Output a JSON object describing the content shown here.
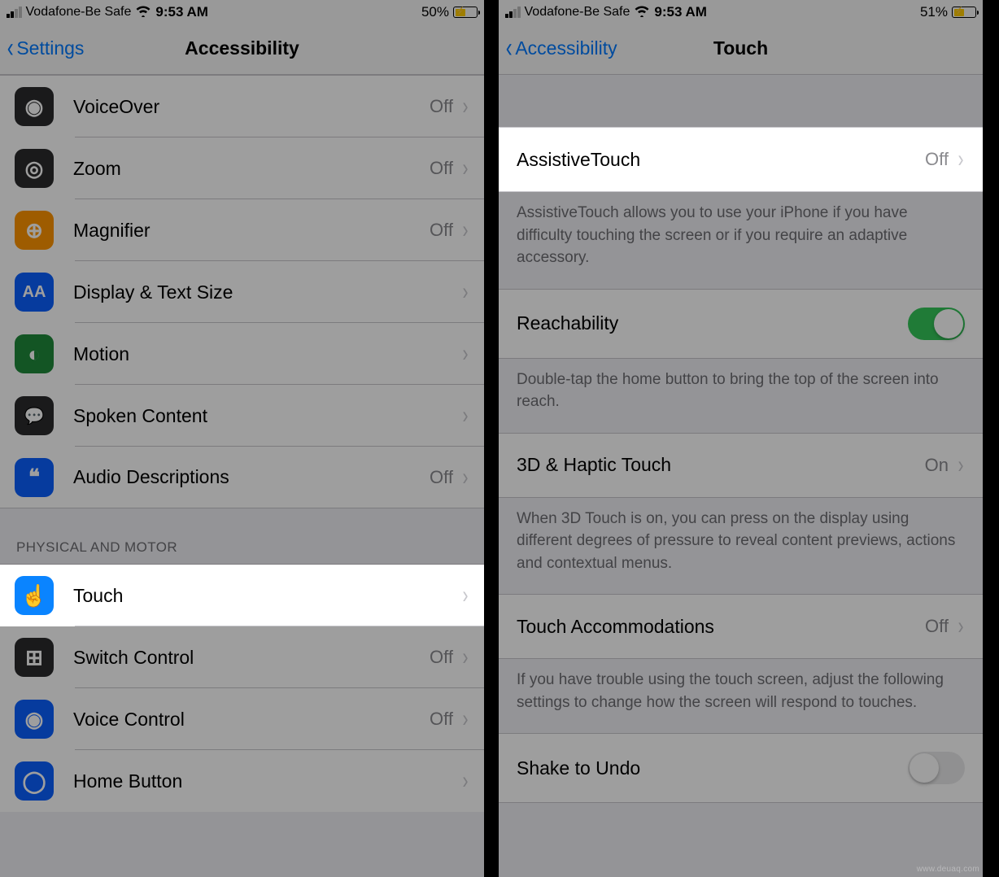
{
  "watermark": "www.deuaq.com",
  "left": {
    "status": {
      "carrier": "Vodafone-Be Safe",
      "time": "9:53 AM",
      "battery_pct": "50%",
      "battery_fill_pct": 50
    },
    "nav": {
      "back_label": "Settings",
      "title": "Accessibility"
    },
    "section1": [
      {
        "icon": "voiceover-icon",
        "label": "VoiceOver",
        "value": "Off",
        "color": "#2b2b2d",
        "glyph": "◉"
      },
      {
        "icon": "zoom-icon",
        "label": "Zoom",
        "value": "Off",
        "color": "#2b2b2d",
        "glyph": "◎"
      },
      {
        "icon": "magnifier-icon",
        "label": "Magnifier",
        "value": "Off",
        "color": "#ff9500",
        "glyph": "⊕"
      },
      {
        "icon": "display-text-icon",
        "label": "Display & Text Size",
        "value": "",
        "color": "#0a60ff",
        "glyph": "AA"
      },
      {
        "icon": "motion-icon",
        "label": "Motion",
        "value": "",
        "color": "#1f8a3b",
        "glyph": "◐"
      },
      {
        "icon": "spoken-content-icon",
        "label": "Spoken Content",
        "value": "",
        "color": "#2b2b2d",
        "glyph": "💬"
      },
      {
        "icon": "audio-descriptions-icon",
        "label": "Audio Descriptions",
        "value": "Off",
        "color": "#0a60ff",
        "glyph": "❝"
      }
    ],
    "section2_header": "PHYSICAL AND MOTOR",
    "section2": [
      {
        "icon": "touch-icon",
        "label": "Touch",
        "value": "",
        "color": "#0a84ff",
        "glyph": "☝",
        "highlight": true
      },
      {
        "icon": "switch-control-icon",
        "label": "Switch Control",
        "value": "Off",
        "color": "#2b2b2d",
        "glyph": "⊞"
      },
      {
        "icon": "voice-control-icon",
        "label": "Voice Control",
        "value": "Off",
        "color": "#0a60ff",
        "glyph": "◉"
      },
      {
        "icon": "home-button-icon",
        "label": "Home Button",
        "value": "",
        "color": "#0a60ff",
        "glyph": "◯"
      }
    ]
  },
  "right": {
    "status": {
      "carrier": "Vodafone-Be Safe",
      "time": "9:53 AM",
      "battery_pct": "51%",
      "battery_fill_pct": 51
    },
    "nav": {
      "back_label": "Accessibility",
      "title": "Touch"
    },
    "groups": [
      {
        "rows": [
          {
            "label": "AssistiveTouch",
            "value": "Off",
            "chevron": true,
            "highlight": true
          }
        ],
        "footer": "AssistiveTouch allows you to use your iPhone if you have difficulty touching the screen or if you require an adaptive accessory."
      },
      {
        "rows": [
          {
            "label": "Reachability",
            "toggle": "on"
          }
        ],
        "footer": "Double-tap the home button to bring the top of the screen into reach."
      },
      {
        "rows": [
          {
            "label": "3D & Haptic Touch",
            "value": "On",
            "chevron": true
          }
        ],
        "footer": "When 3D Touch is on, you can press on the display using different degrees of pressure to reveal content previews, actions and contextual menus."
      },
      {
        "rows": [
          {
            "label": "Touch Accommodations",
            "value": "Off",
            "chevron": true
          }
        ],
        "footer": "If you have trouble using the touch screen, adjust the following settings to change how the screen will respond to touches."
      },
      {
        "rows": [
          {
            "label": "Shake to Undo",
            "toggle": "off"
          }
        ]
      }
    ]
  }
}
